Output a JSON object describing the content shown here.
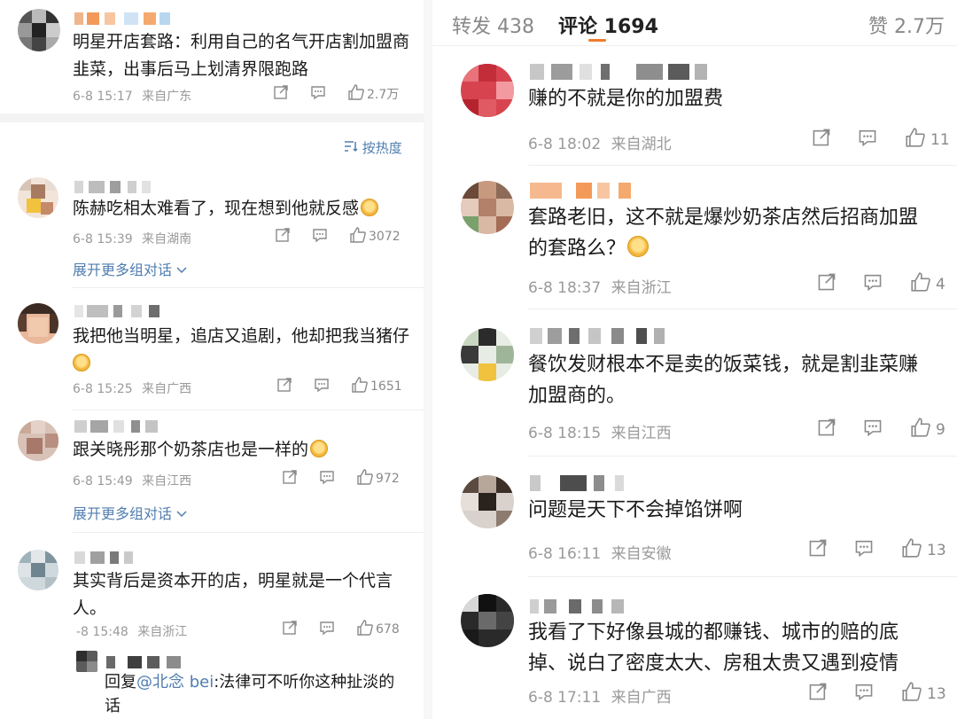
{
  "left": {
    "post": {
      "text_line1": "明星开店套路：利用自己的名气开店割加盟商",
      "text_line2": "韭菜，出事后马上划清界限跑路",
      "time": "6-8 15:17",
      "source": "来自广东",
      "likes": "2.7万"
    },
    "sort_label": "按热度",
    "expand_label": "展开更多组对话",
    "comments": [
      {
        "text": "陈赫吃相太难看了，现在想到他就反感",
        "time": "6-8 15:39",
        "source": "来自湖南",
        "likes": "3072"
      },
      {
        "text_line1": "我把他当明星，追店又追剧，他却把我当猪仔",
        "time": "6-8 15:25",
        "source": "来自广西",
        "likes": "1651"
      },
      {
        "text": "跟关晓彤那个奶茶店也是一样的",
        "time": "6-8 15:49",
        "source": "来自江西",
        "likes": "972"
      },
      {
        "text_line1": "其实背后是资本开的店，明星就是一个代言",
        "text_line2": "人。",
        "time": "-8 15:48",
        "source": "来自浙江",
        "likes": "678"
      }
    ],
    "reply": {
      "prefix": "回复",
      "mention": "@北念 bei",
      "text_line1": ":法律可不听你这种扯淡的",
      "text_line2": "话"
    }
  },
  "right": {
    "tabs": {
      "repost": "转发 438",
      "comment": "评论 1694",
      "like": "赞 2.7万"
    },
    "comments": [
      {
        "text_line1": "赚的不就是你的加盟费",
        "time": "6-8 18:02",
        "source": "来自湖北",
        "likes": "11"
      },
      {
        "text_line1": "套路老旧，这不就是爆炒奶茶店然后招商加盟",
        "text_line2": "的套路么？",
        "time": "6-8 18:37",
        "source": "来自浙江",
        "likes": "4"
      },
      {
        "text_line1": "餐饮发财根本不是卖的饭菜钱，就是割韭菜赚",
        "text_line2": "加盟商的。",
        "time": "6-8 18:15",
        "source": "来自江西",
        "likes": "9"
      },
      {
        "text_line1": "问题是天下不会掉馅饼啊",
        "time": "6-8 16:11",
        "source": "来自安徽",
        "likes": "13"
      },
      {
        "text_line1": "我看了下好像县城的都赚钱、城市的赔的底",
        "text_line2": "掉、说白了密度太大、房租太贵又遇到疫情",
        "time": "6-8 17:11",
        "source": "来自广西",
        "likes": "13"
      }
    ]
  },
  "colors": {
    "link": "#507daf",
    "meta": "#9a9a9a",
    "separator": "#eeeeee"
  }
}
